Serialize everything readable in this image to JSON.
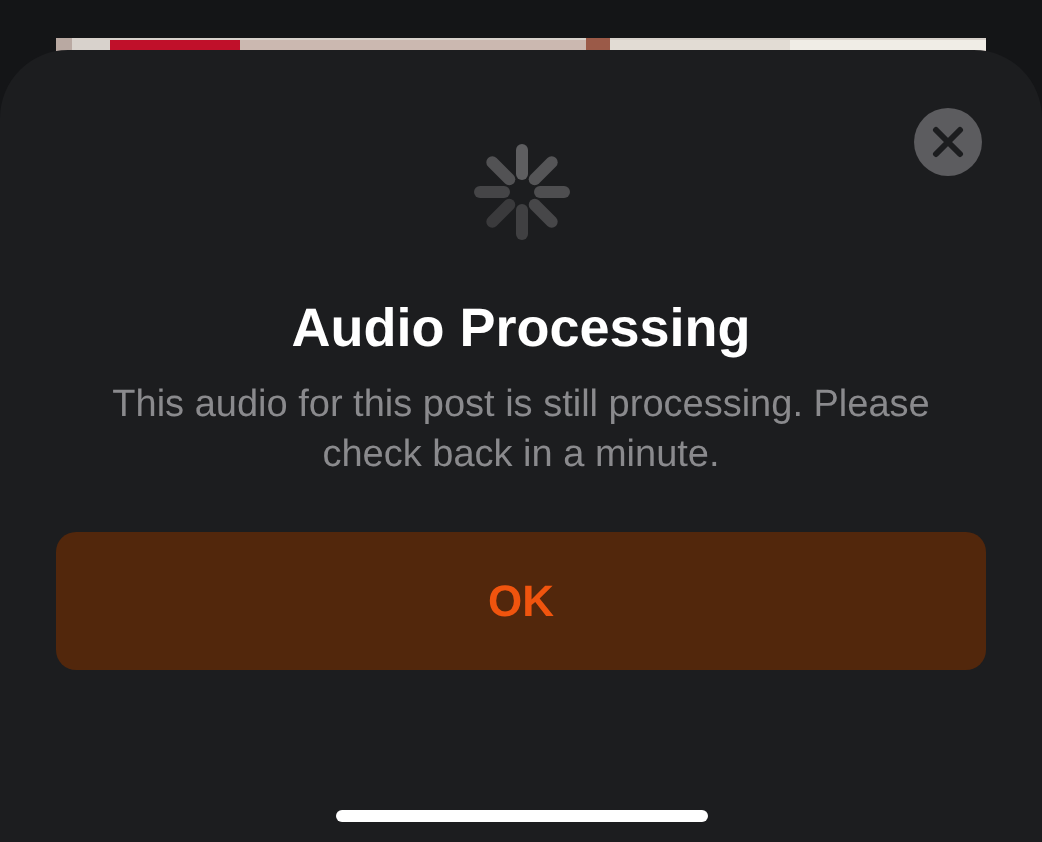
{
  "sheet": {
    "title": "Audio Processing",
    "message": "This audio for this post is still processing. Please check back in a minute.",
    "buttons": [
      "OK"
    ]
  }
}
